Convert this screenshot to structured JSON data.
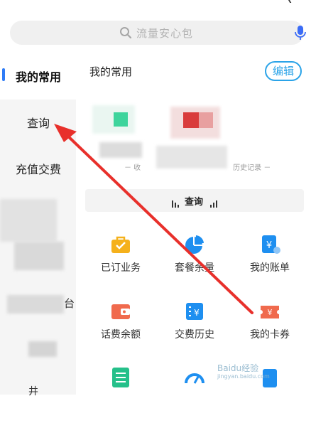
{
  "search": {
    "placeholder": "流量安心包",
    "icon": "search-icon",
    "mic_icon": "microphone-icon"
  },
  "sidebar": {
    "items": [
      {
        "label": "我的常用",
        "active": true
      },
      {
        "label": "查询",
        "active": false
      },
      {
        "label": "充值交费",
        "active": false
      }
    ],
    "partial_text": [
      "台",
      "井"
    ]
  },
  "main": {
    "section_title": "我的常用",
    "edit_label": "编辑",
    "history_text": "－ 收　　　　　　　　　　　　　历史记录 －",
    "query_header": "查询",
    "tiles": [
      {
        "label": "已订业务",
        "icon": "briefcase-icon",
        "color": "#f5b11b"
      },
      {
        "label": "套餐余量",
        "icon": "pie-chart-icon",
        "color": "#1e8ff0"
      },
      {
        "label": "我的账单",
        "icon": "bill-icon",
        "color": "#1e8ff0"
      },
      {
        "label": "话费余额",
        "icon": "wallet-icon",
        "color": "#f06a4d"
      },
      {
        "label": "交费历史",
        "icon": "payment-history-icon",
        "color": "#1e8ff0"
      },
      {
        "label": "我的卡券",
        "icon": "coupon-icon",
        "color": "#f06a4d"
      },
      {
        "label": "",
        "icon": "list-icon",
        "color": "#25c08a"
      },
      {
        "label": "",
        "icon": "speedometer-icon",
        "color": "#1e8ff0"
      },
      {
        "label": "",
        "icon": "service-icon",
        "color": "#1e8ff0"
      }
    ]
  },
  "overlay": {
    "arrow_color": "#e8302b"
  },
  "watermark": {
    "text": "Baidu经验",
    "sub": "jingyan.baidu.com"
  }
}
